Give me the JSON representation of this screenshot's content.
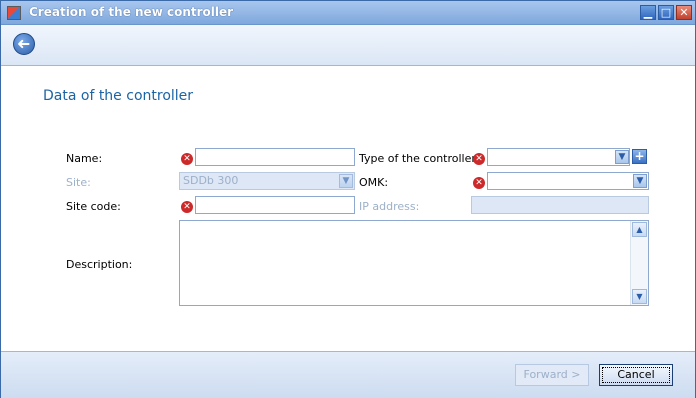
{
  "window": {
    "title": "Creation of the new controller"
  },
  "titlebar": {
    "minimize": "▁",
    "maximize": "□",
    "close": "✕"
  },
  "toolbar": {
    "back_glyph": "➜"
  },
  "section": {
    "title": "Data of the controller"
  },
  "form": {
    "name": {
      "label": "Name:",
      "value": ""
    },
    "site": {
      "label": "Site:",
      "value": "SDDb 300"
    },
    "site_code": {
      "label": "Site code:",
      "value": ""
    },
    "description": {
      "label": "Description:",
      "value": ""
    },
    "controller_type": {
      "label": "Type of the controller:",
      "value": ""
    },
    "omk": {
      "label": "OMK:",
      "value": ""
    },
    "ip_address": {
      "label": "IP address:",
      "value": ""
    }
  },
  "icons": {
    "error": "✕",
    "combo_arrow": "▼",
    "plus": "+",
    "scroll_up": "▲",
    "scroll_down": "▼"
  },
  "footer": {
    "forward_label": "Forward >",
    "cancel_label": "Cancel"
  }
}
